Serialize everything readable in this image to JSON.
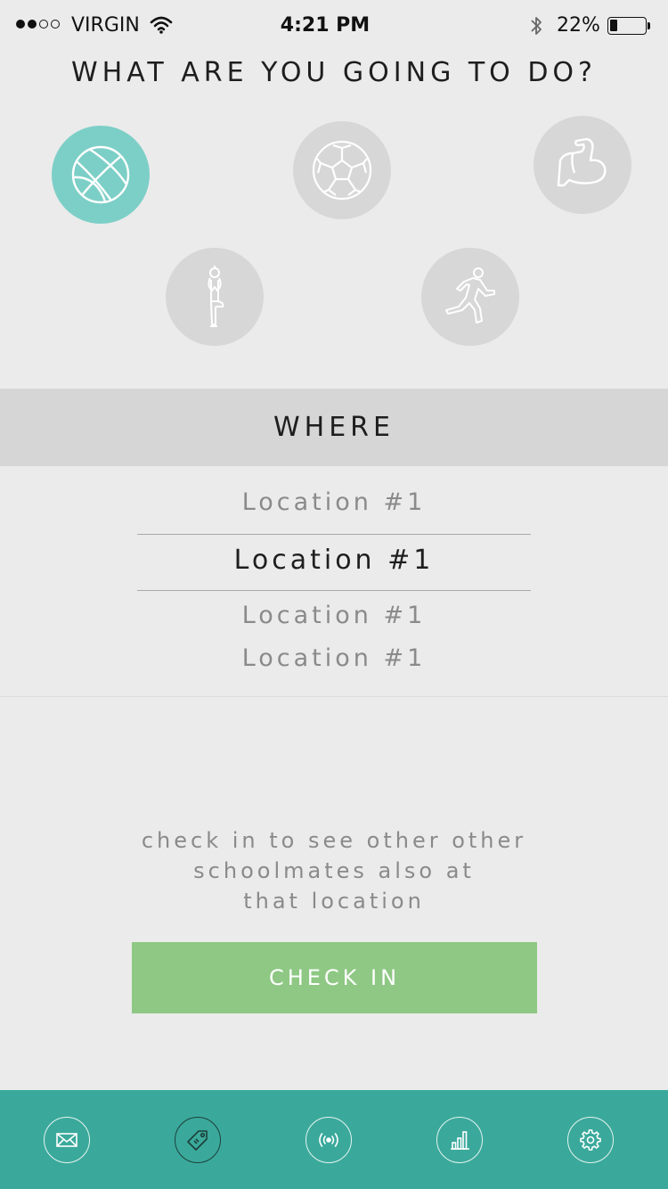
{
  "status_bar": {
    "signal_dots_filled": 2,
    "signal_dots_total": 4,
    "carrier": "VIRGIN",
    "time": "4:21 PM",
    "battery_percent": "22%",
    "battery_level": 0.22,
    "wifi_icon": "wifi-icon",
    "bluetooth_icon": "bluetooth-icon"
  },
  "question": "WHAT ARE YOU GOING TO DO?",
  "activities": [
    {
      "icon": "basketball-icon",
      "selected": true
    },
    {
      "icon": "soccer-ball-icon",
      "selected": false
    },
    {
      "icon": "flexed-arm-icon",
      "selected": false
    },
    {
      "icon": "yoga-pose-icon",
      "selected": false
    },
    {
      "icon": "runner-icon",
      "selected": false
    }
  ],
  "where_title": "WHERE",
  "locations": [
    "Location #1",
    "Location #1",
    "Location #1",
    "Location #1"
  ],
  "selected_location_index": 1,
  "hint_lines": [
    "check in to see other other",
    "schoolmates also at",
    "that location"
  ],
  "check_in_label": "CHECK IN",
  "tabs": [
    {
      "icon": "mail-icon",
      "active": false
    },
    {
      "icon": "tag-icon",
      "active": true
    },
    {
      "icon": "broadcast-icon",
      "active": false
    },
    {
      "icon": "bar-chart-icon",
      "active": false
    },
    {
      "icon": "settings-gear-icon",
      "active": false
    }
  ],
  "colors": {
    "background": "#ebebeb",
    "selected_activity": "#7ccfc7",
    "activity_idle": "#d7d7d7",
    "where_bar": "#d6d6d6",
    "check_in_button": "#8ec884",
    "tab_bar": "#3aa99b"
  }
}
